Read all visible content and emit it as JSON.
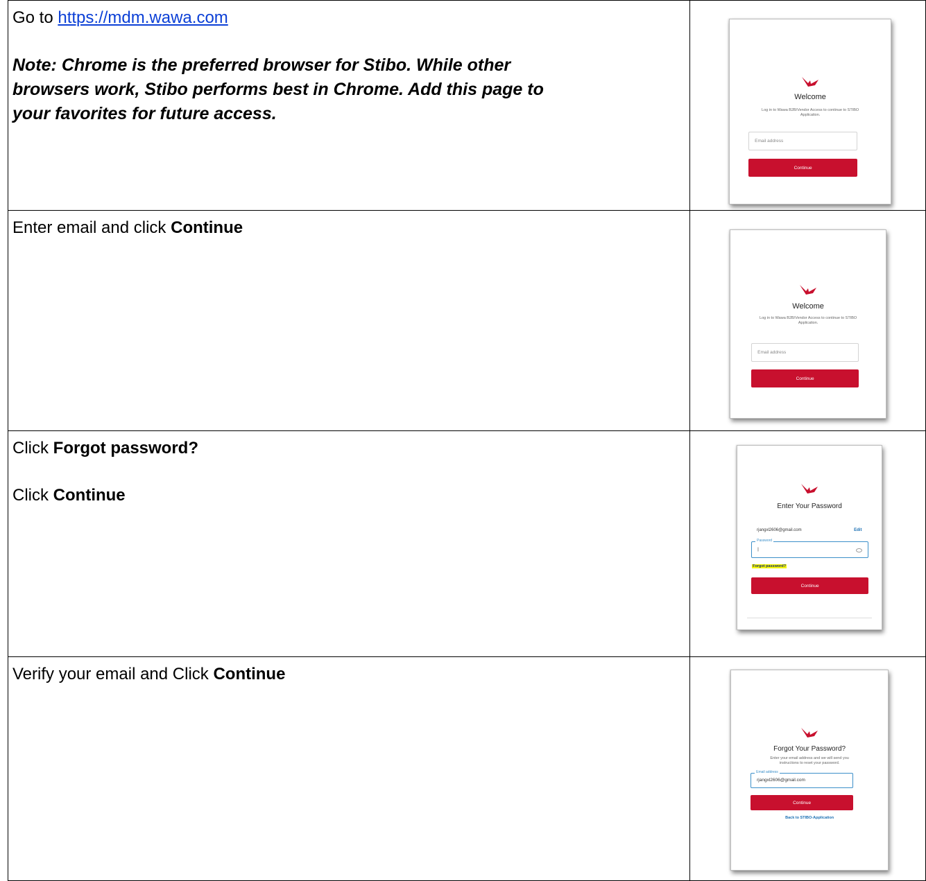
{
  "rows": [
    {
      "go_to": "Go to",
      "url": "https://mdm.wawa.com",
      "note": [
        "Note: Chrome is the preferred browser for Stibo. While other",
        "browsers work, Stibo performs best in Chrome.  Add this page to",
        "your favorites for future access."
      ],
      "card": {
        "title": "Welcome",
        "subtitle": "Log in to Wawa B2B/Vendor Access to continue to STIBO Application.",
        "input_placeholder": "Email address",
        "button": "Continue"
      }
    },
    {
      "text": "Enter email and click",
      "bold": "Continue",
      "card": {
        "title": "Welcome",
        "subtitle": "Log in to Wawa B2B/Vendor Access to continue to STIBO Application.",
        "input_placeholder": "Email address",
        "button": "Continue"
      }
    },
    {
      "line1_text": "Click",
      "line1_bold": "Forgot password?",
      "line2_text": "Click",
      "line2_bold": "Continue",
      "card": {
        "title": "Enter Your Password",
        "email": "rjangxl2606@gmail.com",
        "edit": "Edit",
        "password_label": "Password",
        "password_value": "|",
        "forgot": "Forgot password?",
        "button": "Continue"
      }
    },
    {
      "text": "Verify your email and Click",
      "bold": "Continue",
      "card": {
        "title": "Forgot Your Password?",
        "subtitle": "Enter your email address and we will send you instructions to reset your password.",
        "email_label": "Email address",
        "email_value": "rjangxl2606@gmail.com",
        "button": "Continue",
        "back": "Back to STIBO-Application"
      }
    }
  ],
  "colors": {
    "brand_red": "#c8102e",
    "link_blue": "#0b3fd6",
    "highlight": "#f4f70a"
  }
}
